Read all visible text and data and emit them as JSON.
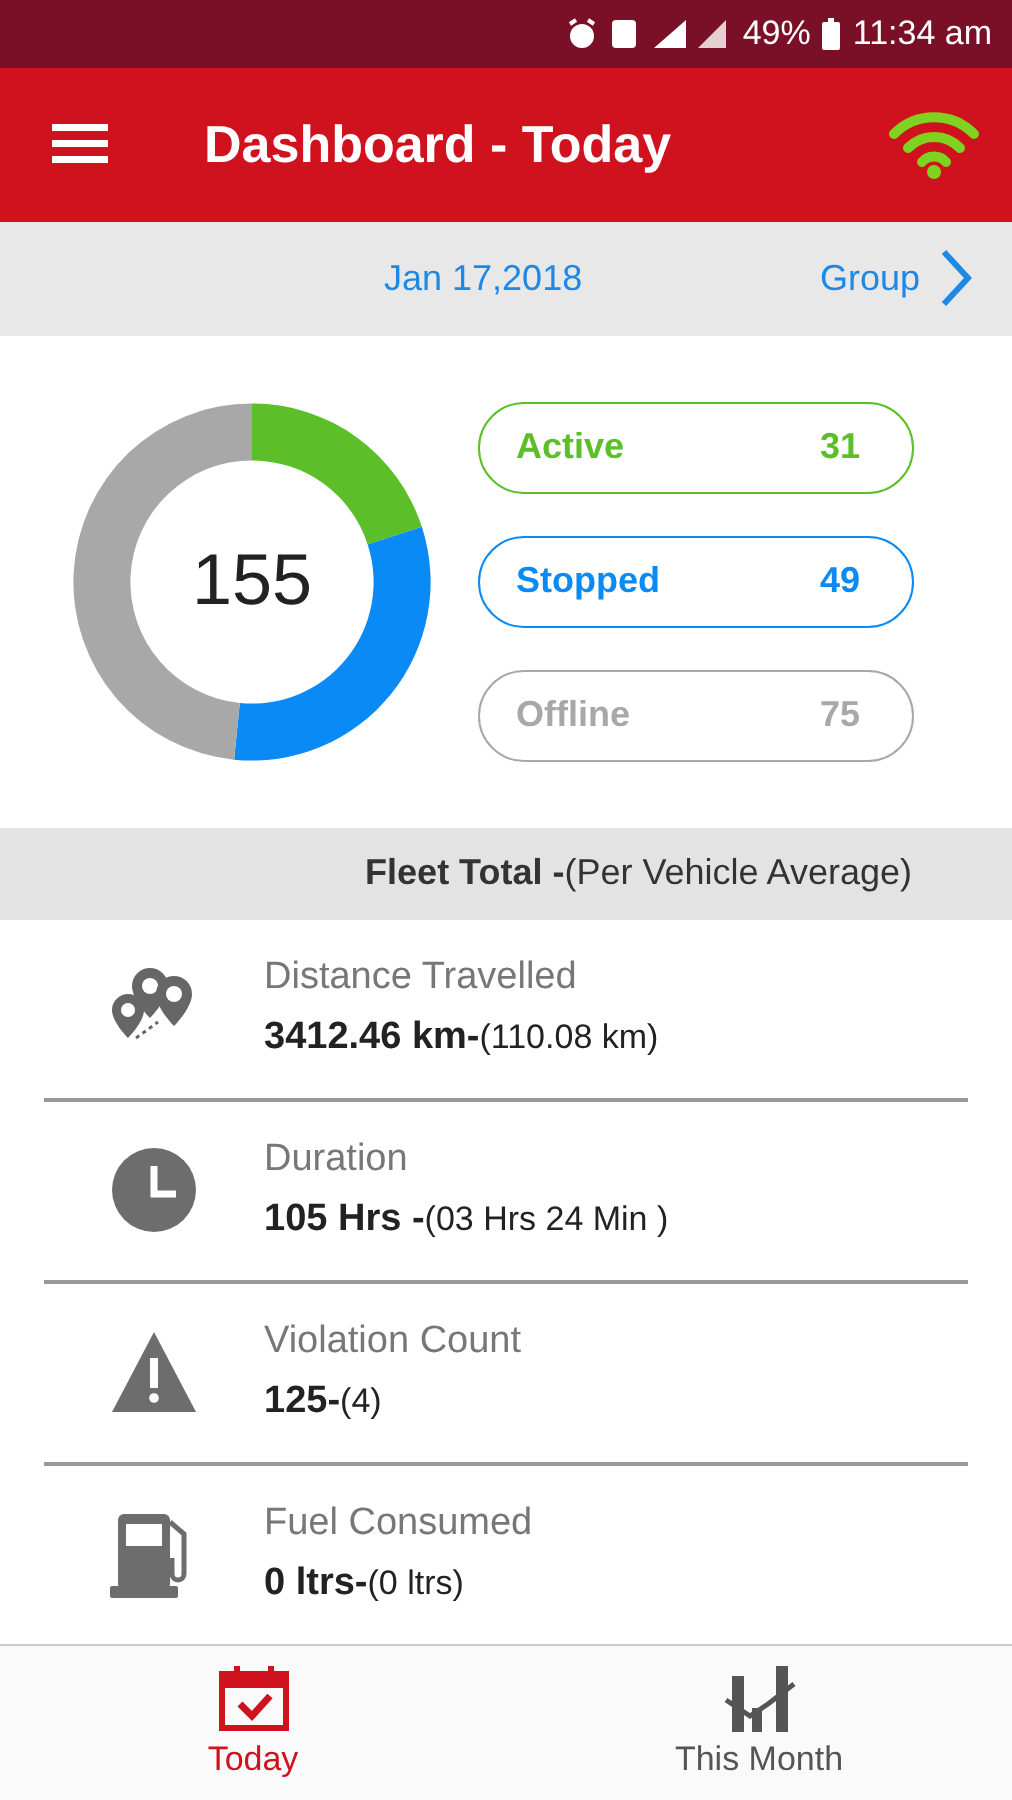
{
  "status_bar": {
    "battery": "49%",
    "time": "11:34 am"
  },
  "app_bar": {
    "title": "Dashboard - Today"
  },
  "date_bar": {
    "date": "Jan 17,2018",
    "group": "Group"
  },
  "summary": {
    "total": "155",
    "chart_data": {
      "type": "donut",
      "values": [
        20,
        31.6,
        48.4
      ]
    },
    "pills": [
      {
        "label": "Active",
        "count": "31",
        "color": "#5cbf2a"
      },
      {
        "label": "Stopped",
        "count": "49",
        "color": "#0a8af5"
      },
      {
        "label": "Offline",
        "count": "75",
        "color": "#a8a8a8"
      }
    ]
  },
  "fleet_header": "**Fleet Total -**(Per Vehicle Average)",
  "metrics": [
    {
      "kind": "distance",
      "title": "Distance Travelled",
      "value": "**3412.46 km-**(110.08 km)"
    },
    {
      "kind": "duration",
      "title": "Duration",
      "value": "**105 Hrs -**(03 Hrs 24 Min )"
    },
    {
      "kind": "violation",
      "title": "Violation Count",
      "value": "**125-**(4)"
    },
    {
      "kind": "fuel",
      "title": "Fuel Consumed",
      "value": "**0 ltrs-**(0 ltrs)"
    }
  ],
  "bottom_nav": [
    {
      "kind": "today",
      "label": "Today",
      "selected": true
    },
    {
      "kind": "month",
      "label": "This Month",
      "selected": false
    }
  ]
}
